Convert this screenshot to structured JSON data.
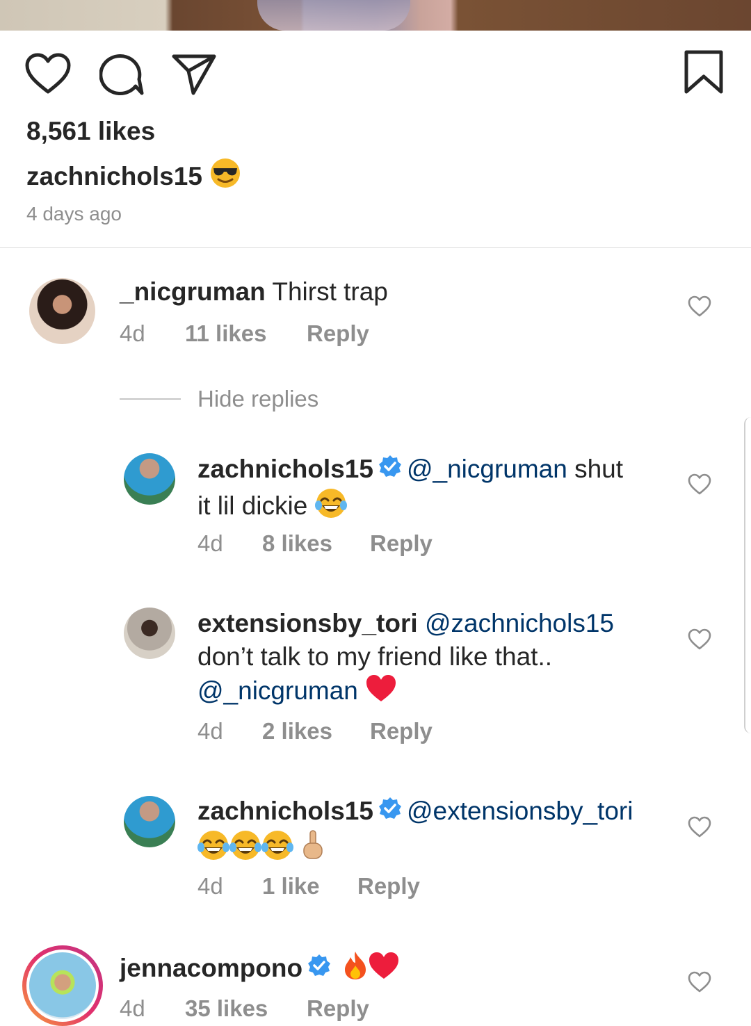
{
  "post": {
    "likes_text": "8,561 likes",
    "caption_user": "zachnichols15",
    "caption_emoji": "smiling-face-with-sunglasses",
    "time_ago": "4 days ago"
  },
  "icons": {
    "like": "heart-outline-icon",
    "comment": "speech-bubble-icon",
    "share": "paper-plane-icon",
    "save": "bookmark-icon"
  },
  "comments": [
    {
      "user": "_nicgruman",
      "text": "Thirst trap",
      "time": "4d",
      "likes": "11 likes",
      "reply": "Reply"
    }
  ],
  "hide_replies": "Hide replies",
  "replies": [
    {
      "user": "zachnichols15",
      "verified": true,
      "mention": "@_nicgruman",
      "text_a": " shut",
      "text_b": "it lil dickie",
      "emoji": "face-with-tears-of-joy",
      "time": "4d",
      "likes": "8 likes",
      "reply": "Reply"
    },
    {
      "user": "extensionsby_tori",
      "mention": "@zachnichols15",
      "text_b": "don’t talk to my friend like that..",
      "mention2": "@_nicgruman",
      "emoji": "red-heart",
      "time": "4d",
      "likes": "2 likes",
      "reply": "Reply"
    },
    {
      "user": "zachnichols15",
      "verified": true,
      "mention": "@extensionsby_tori",
      "emoji": "face-with-tears-of-joy x3, middle-finger",
      "time": "4d",
      "likes": "1 like",
      "reply": "Reply"
    }
  ],
  "comment2": {
    "user": "jennacompono",
    "verified": true,
    "emoji": "fire, red-heart",
    "time": "4d",
    "likes": "35 likes",
    "reply": "Reply"
  },
  "colors": {
    "text": "#262626",
    "muted": "#8e8e8e",
    "mention": "#003569",
    "verified": "#3897f0",
    "heart": "#ed1d3c"
  }
}
